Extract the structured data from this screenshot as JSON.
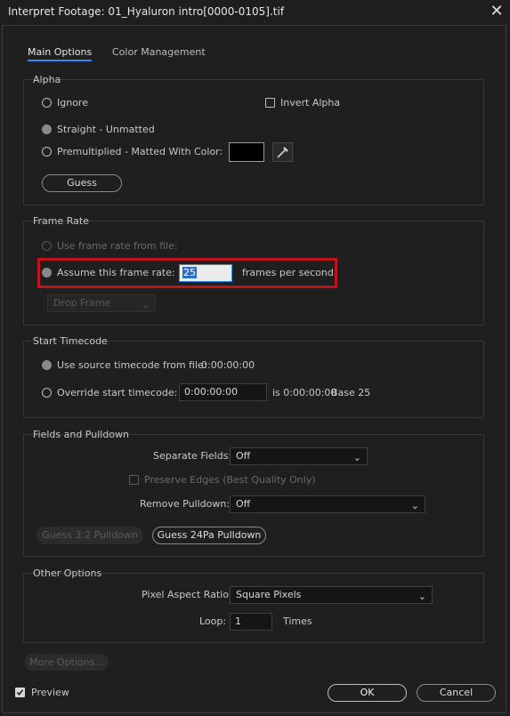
{
  "window": {
    "title": "Interpret Footage: 01_Hyaluron intro[0000-0105].tif",
    "close_icon": "close-icon"
  },
  "tabs": [
    {
      "label": "Main Options",
      "active": true
    },
    {
      "label": "Color Management",
      "active": false
    }
  ],
  "alpha": {
    "title": "Alpha",
    "ignore": "Ignore",
    "invert": "Invert Alpha",
    "straight": "Straight - Unmatted",
    "premultiplied": "Premultiplied - Matted With Color:",
    "matte_color": "#000000",
    "guess": "Guess"
  },
  "frame_rate": {
    "title": "Frame Rate",
    "use_file": "Use frame rate from file:",
    "assume": "Assume this frame rate:",
    "value": "25",
    "fps_label": "frames per second",
    "drop_frame": "Drop Frame",
    "highlight_color": "#c2121c"
  },
  "timecode": {
    "title": "Start Timecode",
    "use_source": "Use source timecode from file:",
    "source_value": "0:00:00:00",
    "override": "Override start timecode:",
    "override_value": "0:00:00:00",
    "is_label": "is 0:00:00:00",
    "base": "Base 25"
  },
  "fields": {
    "title": "Fields and Pulldown",
    "separate_label": "Separate Fields:",
    "separate_value": "Off",
    "preserve": "Preserve Edges (Best Quality Only)",
    "remove_label": "Remove Pulldown:",
    "remove_value": "Off",
    "guess32": "Guess 3:2 Pulldown",
    "guess24": "Guess 24Pa Pulldown"
  },
  "other": {
    "title": "Other Options",
    "par_label": "Pixel Aspect Ratio:",
    "par_value": "Square Pixels",
    "loop_label": "Loop:",
    "loop_value": "1",
    "times": "Times"
  },
  "footer": {
    "more": "More Options...",
    "preview": "Preview",
    "preview_checked": true,
    "ok": "OK",
    "cancel": "Cancel",
    "accent": "#2d8ceb"
  }
}
